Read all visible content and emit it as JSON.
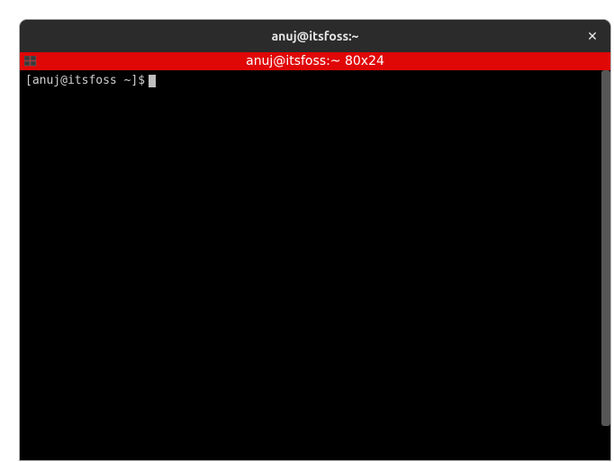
{
  "window": {
    "title": "anuj@itsfoss:~"
  },
  "tab": {
    "label": "anuj@itsfoss:~ 80x24"
  },
  "terminal": {
    "prompt": "[anuj@itsfoss ~]$"
  },
  "colors": {
    "tab_background": "#e00707",
    "titlebar_background": "#2b2b2b",
    "terminal_background": "#000000"
  }
}
